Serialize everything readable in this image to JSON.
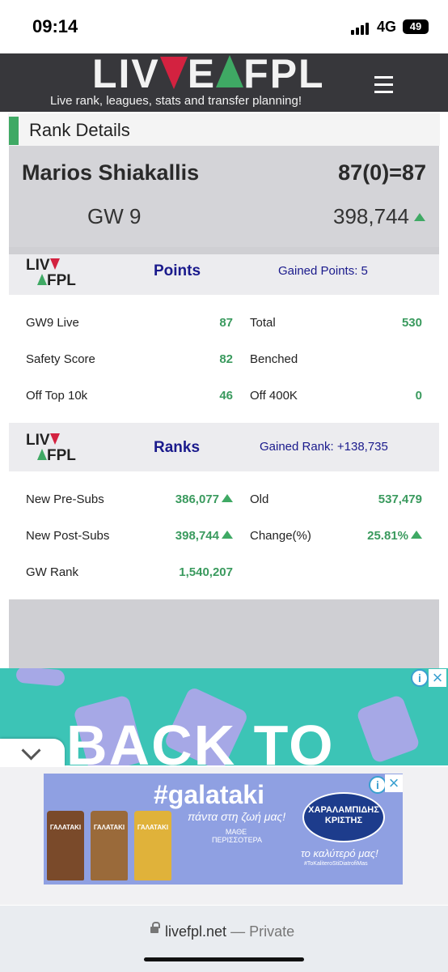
{
  "status_bar": {
    "time": "09:14",
    "network": "4G",
    "battery": "49"
  },
  "header": {
    "logo_left": "LIV",
    "logo_right": "FPL",
    "tagline": "Live rank, leagues, stats and transfer planning!"
  },
  "rank_details": {
    "title": "Rank Details",
    "manager_name": "Marios Shiakallis",
    "score_formula": "87(0)=87",
    "gameweek": "GW 9",
    "overall_rank": "398,744"
  },
  "points_card": {
    "logo_top": "LIV",
    "logo_bottom": "FPL",
    "title": "Points",
    "gained": "Gained Points: 5",
    "rows": [
      {
        "label": "GW9 Live",
        "value": "87",
        "label2": "Total",
        "value2": "530"
      },
      {
        "label": "Safety Score",
        "value": "82",
        "label2": "Benched",
        "value2": ""
      },
      {
        "label": "Off Top 10k",
        "value": "46",
        "label2": "Off 400K",
        "value2": "0"
      }
    ]
  },
  "ranks_card": {
    "logo_top": "LIV",
    "logo_bottom": "FPL",
    "title": "Ranks",
    "gained": "Gained Rank: +138,735",
    "rows": [
      {
        "label": "New Pre-Subs",
        "value": "386,077",
        "label2": "Old",
        "value2": "537,479"
      },
      {
        "label": "New Post-Subs",
        "value": "398,744",
        "label2": "Change(%)",
        "value2": "25.81%"
      },
      {
        "label": "GW Rank",
        "value": "1,540,207",
        "label2": "",
        "value2": ""
      }
    ]
  },
  "ads": {
    "top_text": "BACK TO",
    "hashtag": "#galataki",
    "subtitle": "πάντα στη ζωή μας!",
    "more": "ΜΑΘΕ ΠΕΡΙΣΣΟΤΕΡΑ",
    "brand": "ΧΑΡΑΛΑΜΠΙΔΗΣ ΚΡΙΣΤΗΣ",
    "slogan": "το καλύτερό μας!",
    "tag": "#ToKaliteroStiDiatrofiMas",
    "carton_label": "ΓΑΛΑΤΑΚΙ"
  },
  "browser": {
    "url": "livefpl.net",
    "separator": "—",
    "mode": "Private"
  },
  "colors": {
    "header_bg": "#37373b",
    "accent_green": "#3fa964",
    "accent_red": "#d32240",
    "card_title": "#1a1a8c"
  }
}
